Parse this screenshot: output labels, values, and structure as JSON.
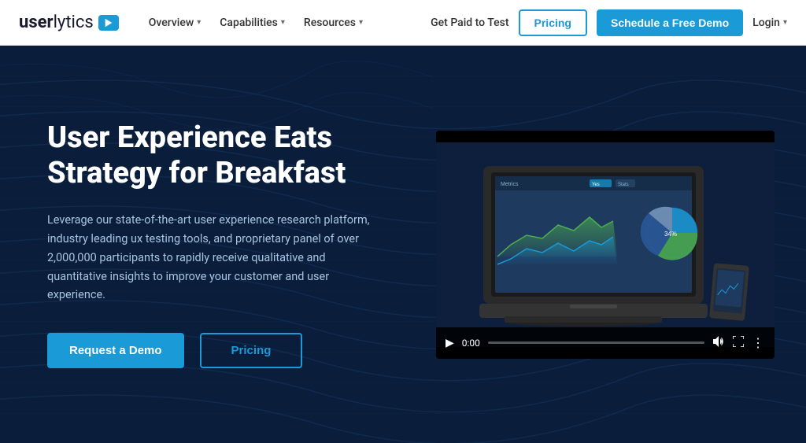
{
  "logo": {
    "text_user": "user",
    "text_lytics": "lytics"
  },
  "nav": {
    "items": [
      {
        "label": "Overview",
        "has_dropdown": true
      },
      {
        "label": "Capabilities",
        "has_dropdown": true
      },
      {
        "label": "Resources",
        "has_dropdown": true
      }
    ],
    "right_items": {
      "get_paid": "Get Paid to Test",
      "pricing": "Pricing",
      "schedule_demo": "Schedule a Free Demo",
      "login": "Login"
    }
  },
  "hero": {
    "title": "User Experience Eats Strategy for Breakfast",
    "subtitle": "Leverage our state-of-the-art user experience research platform, industry leading ux testing tools, and proprietary panel of over 2,000,000 participants to rapidly receive qualitative and quantitative insights to improve your customer and user experience.",
    "btn_demo": "Request a Demo",
    "btn_pricing": "Pricing"
  },
  "video": {
    "time": "0:00"
  },
  "colors": {
    "primary": "#1a9ad7",
    "hero_bg": "#0a1d3a",
    "nav_bg": "#ffffff"
  }
}
